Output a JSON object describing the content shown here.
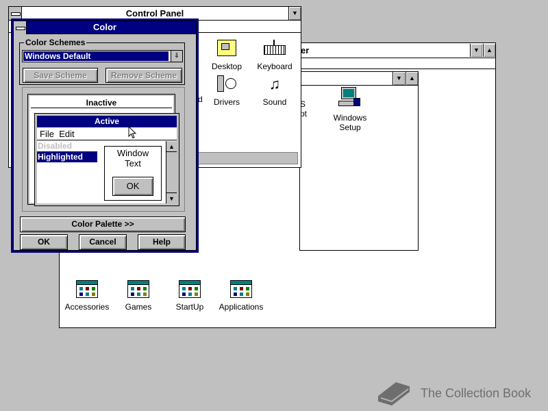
{
  "control_panel": {
    "title": "Control Panel",
    "icons": [
      {
        "label": "Desktop"
      },
      {
        "label": "Keyboard"
      },
      {
        "label": "Drivers"
      },
      {
        "label": "Sound"
      },
      {
        "label": "d"
      }
    ]
  },
  "program_manager": {
    "title_fragment": "er",
    "main_group": {
      "icons": [
        {
          "label": "Windows Setup",
          "line1": "Windows",
          "line2": "Setup"
        }
      ],
      "partial_label_line1": "S",
      "partial_label_line2": "pt"
    },
    "groups": [
      {
        "label": "Accessories"
      },
      {
        "label": "Games"
      },
      {
        "label": "StartUp"
      },
      {
        "label": "Applications"
      }
    ]
  },
  "color_dialog": {
    "title": "Color",
    "color_schemes_label": "Color Schemes",
    "scheme_value": "Windows Default",
    "save_scheme_label": "Save Scheme",
    "remove_scheme_label": "Remove Scheme",
    "preview": {
      "inactive_title": "Inactive",
      "active_title": "Active",
      "menu_file": "File",
      "menu_edit": "Edit",
      "disabled_text": "Disabled",
      "highlighted_text": "Highlighted",
      "window_text_line1": "Window",
      "window_text_line2": "Text",
      "ok_label": "OK"
    },
    "color_palette_label": "Color Palette >>",
    "ok_label": "OK",
    "cancel_label": "Cancel",
    "help_label": "Help"
  },
  "watermark": {
    "text": "The Collection Book"
  },
  "colors": {
    "desktop": "#c0c0c0",
    "title_active": "#000080",
    "highlight": "#000080"
  }
}
